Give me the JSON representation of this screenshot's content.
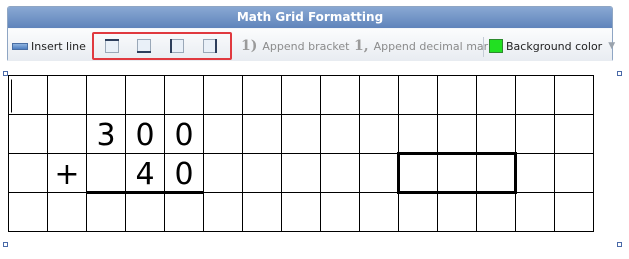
{
  "toolbar": {
    "title": "Math Grid Formatting",
    "insert_line_label": "Insert line",
    "border_buttons": [
      "border-top",
      "border-bottom",
      "border-left",
      "border-right"
    ],
    "append_bracket_glyph": "1)",
    "append_bracket_label": "Append bracket",
    "append_decimal_glyph": "1,",
    "append_decimal_label": "Append decimal mark",
    "background_color_label": "Background color",
    "background_color": "#22e022"
  },
  "grid": {
    "rows": 4,
    "cols": 15,
    "cells": [
      {
        "row": 1,
        "col": 2,
        "text": "3"
      },
      {
        "row": 1,
        "col": 3,
        "text": "0"
      },
      {
        "row": 1,
        "col": 4,
        "text": "0"
      },
      {
        "row": 2,
        "col": 1,
        "text": "+"
      },
      {
        "row": 2,
        "col": 3,
        "text": "4"
      },
      {
        "row": 2,
        "col": 4,
        "text": "0"
      }
    ],
    "underline": {
      "row": 2,
      "from_col": 2,
      "to_col": 4
    },
    "bold_box": {
      "row": 2,
      "from_col": 10,
      "to_col": 12
    },
    "caret": {
      "row": 0,
      "col": 0
    }
  },
  "colors": {
    "highlight_border": "#e0393f",
    "title_bar": "#6f92c7",
    "grid_line": "#000000"
  }
}
